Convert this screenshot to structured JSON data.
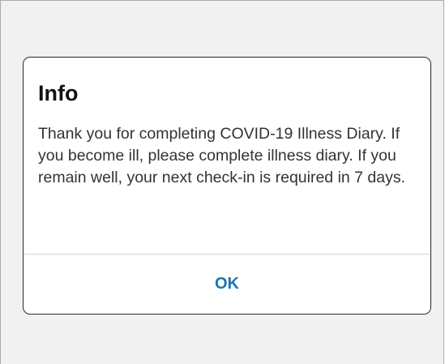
{
  "dialog": {
    "title": "Info",
    "message": "Thank you for completing COVID-19 Illness Diary. If you become ill, please complete illness diary. If you remain well, your next check-in is required in 7 days.",
    "ok_label": "OK"
  },
  "colors": {
    "accent": "#1a73b4",
    "backdrop": "#f1f1f1",
    "dialog_border": "#2b2b2b"
  }
}
